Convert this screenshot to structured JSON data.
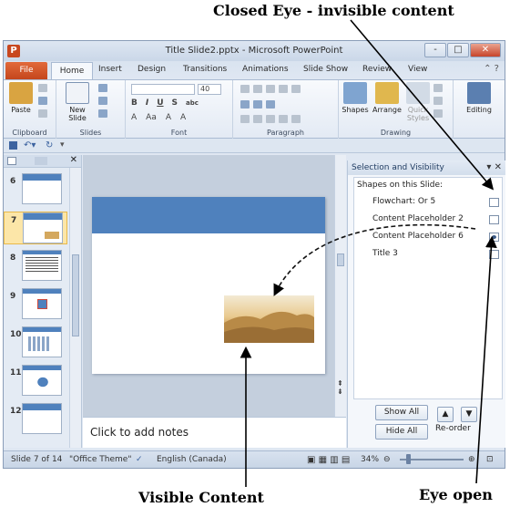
{
  "annotations": {
    "top": "Closed Eye - invisible content",
    "bottom_left": "Visible Content",
    "bottom_right": "Eye open"
  },
  "window": {
    "title": "Title Slide2.pptx - Microsoft PowerPoint",
    "app_icon": "P",
    "controls": [
      "-",
      "□",
      "✕"
    ]
  },
  "tabs": [
    "File",
    "Home",
    "Insert",
    "Design",
    "Transitions",
    "Animations",
    "Slide Show",
    "Review",
    "View"
  ],
  "ribbon": {
    "groups": [
      "Clipboard",
      "Slides",
      "Font",
      "Paragraph",
      "Drawing"
    ],
    "paste": "Paste",
    "new_slide": "New Slide",
    "font_size": "40",
    "shapes": "Shapes",
    "arrange": "Arrange",
    "quick_styles": "Quick Styles",
    "editing": "Editing",
    "font_buttons": [
      "B",
      "I",
      "U",
      "S",
      "abc"
    ],
    "font_row2": [
      "A",
      "Aa",
      "A",
      "A"
    ]
  },
  "thumbnails": [
    {
      "num": "6",
      "selected": false
    },
    {
      "num": "7",
      "selected": true
    },
    {
      "num": "8",
      "selected": false
    },
    {
      "num": "9",
      "selected": false
    },
    {
      "num": "10",
      "selected": false
    },
    {
      "num": "11",
      "selected": false
    },
    {
      "num": "12",
      "selected": false
    }
  ],
  "notes": {
    "placeholder": "Click to add notes"
  },
  "selection_pane": {
    "title": "Selection and Visibility",
    "caption": "Shapes on this Slide:",
    "shapes": [
      {
        "name": "Flowchart: Or 5",
        "visible": false
      },
      {
        "name": "Content Placeholder 2",
        "visible": false
      },
      {
        "name": "Content Placeholder 6",
        "visible": true
      },
      {
        "name": "Title 3",
        "visible": false
      }
    ],
    "show_all": "Show All",
    "hide_all": "Hide All",
    "reorder": "Re-order"
  },
  "status": {
    "slide": "Slide 7 of 14",
    "theme": "\"Office Theme\"",
    "language": "English (Canada)",
    "zoom": "34%"
  },
  "colors": {
    "accent": "#4f81bd",
    "file_tab": "#c4461d",
    "selected_thumb": "#fce6a8"
  }
}
